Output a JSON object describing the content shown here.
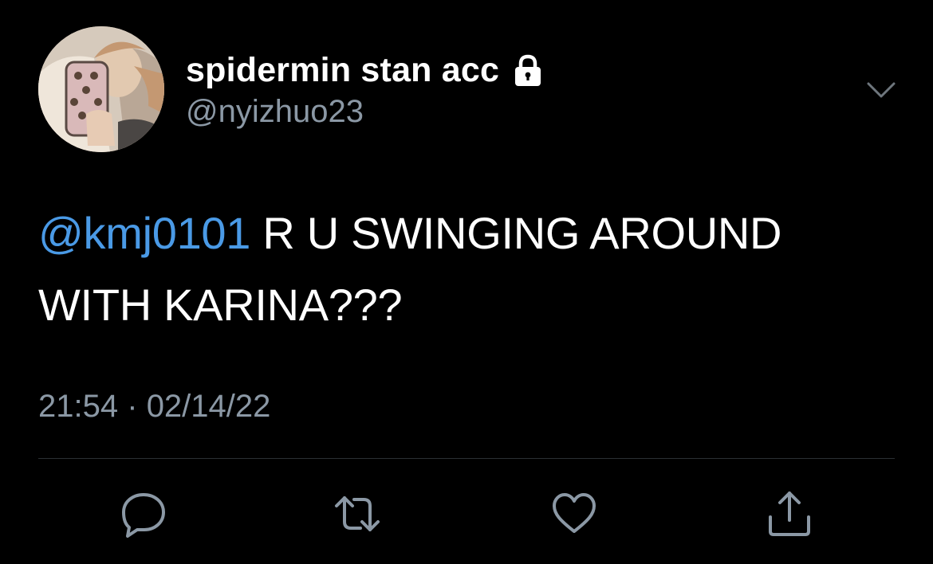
{
  "user": {
    "display_name": "spidermin stan acc",
    "handle": "@nyizhuo23",
    "protected": true
  },
  "tweet": {
    "mention": "@kmj0101",
    "text": " R U SWINGING AROUND WITH KARINA???",
    "time": "21:54",
    "separator": "·",
    "date": "02/14/22"
  },
  "actions": [
    {
      "name": "reply",
      "icon": "reply-icon"
    },
    {
      "name": "retweet",
      "icon": "retweet-icon"
    },
    {
      "name": "like",
      "icon": "heart-icon"
    },
    {
      "name": "share",
      "icon": "share-icon"
    }
  ],
  "colors": {
    "background": "#000000",
    "text": "#ffffff",
    "secondary_text": "#8b98a5",
    "mention": "#4a9ae6",
    "divider": "#2b2f33"
  }
}
